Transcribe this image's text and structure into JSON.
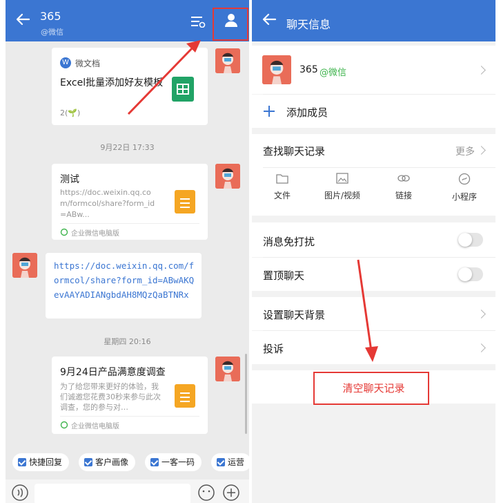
{
  "left": {
    "header": {
      "title": "365",
      "subtitle": "@微信"
    },
    "messages": [
      {
        "source": "微文档",
        "source_badge": "W",
        "title": "Excel批量添加好友模板",
        "meta": "2(🌱)"
      },
      {
        "timestamp": "9月22日 17:33"
      },
      {
        "title": "测试",
        "desc": "https://doc.weixin.qq.com/formcol/share?form_id=ABw...",
        "footer": "企业微信电脑版"
      },
      {
        "link_text": "https://doc.weixin.qq.com/formcol/share?form_id=ABwAKQevAAYADIANgbdAH8MQzQaBTNRx"
      },
      {
        "timestamp": "星期四 20:16"
      },
      {
        "title": "9月24日产品满意度调查",
        "desc": "为了给您带来更好的体验，我们诚邀您花费30秒来参与此次调查，您的参与对…",
        "footer": "企业微信电脑版"
      }
    ],
    "quick_actions": [
      "快捷回复",
      "客户画像",
      "一客一码",
      "运营"
    ]
  },
  "right": {
    "header": {
      "title": "聊天信息"
    },
    "contact": {
      "name": "365",
      "tag": "@微信"
    },
    "add_member": "添加成员",
    "search_history": {
      "label": "查找聊天记录",
      "more": "更多"
    },
    "categories": [
      {
        "label": "文件",
        "icon": "folder-icon"
      },
      {
        "label": "图片/视频",
        "icon": "image-icon"
      },
      {
        "label": "链接",
        "icon": "link-icon"
      },
      {
        "label": "小程序",
        "icon": "mini-program-icon"
      }
    ],
    "settings": [
      {
        "label": "消息免打扰",
        "type": "toggle",
        "on": false
      },
      {
        "label": "置顶聊天",
        "type": "toggle",
        "on": false
      }
    ],
    "set_background": "设置聊天背景",
    "report": "投诉",
    "clear_history": "清空聊天记录"
  },
  "colors": {
    "header": "#3b76d2",
    "accent_red": "#e53935",
    "link": "#3b76d2",
    "wechat_green": "#3fb44d"
  }
}
